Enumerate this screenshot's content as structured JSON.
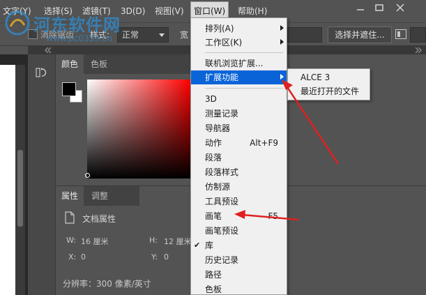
{
  "menubar": {
    "items": [
      {
        "label": "文字(Y)"
      },
      {
        "label": "选择(S)"
      },
      {
        "label": "滤镜(T)"
      },
      {
        "label": "3D(D)"
      },
      {
        "label": "视图(V)"
      },
      {
        "label": "窗口(W)"
      },
      {
        "label": "帮助(H)"
      }
    ]
  },
  "options_bar": {
    "feather_label": "消除锯齿",
    "style_label": "样式:",
    "style_value": "正常",
    "width_label": "宽",
    "select_mask_button": "选择并遮住..."
  },
  "color_panel": {
    "tabs": [
      {
        "label": "颜色"
      },
      {
        "label": "色板"
      }
    ],
    "foreground_color": "#000000",
    "background_color": "#ffffff"
  },
  "properties_panel": {
    "tabs": [
      {
        "label": "属性"
      },
      {
        "label": "调整"
      }
    ],
    "doc_props_label": "文档属性",
    "w_label": "W:",
    "w_value": "16 厘米",
    "h_label": "H:",
    "h_value": "12 厘米",
    "x_label": "X:",
    "x_value": "0",
    "y_label": "Y:",
    "y_value": "0",
    "resolution": "分辨率：300 像素/英寸"
  },
  "window_menu": {
    "items": [
      {
        "label": "排列(A)",
        "submenu": true
      },
      {
        "label": "工作区(K)",
        "submenu": true
      },
      {
        "label": "联机浏览扩展..."
      },
      {
        "label": "扩展功能",
        "submenu": true,
        "highlighted": true
      },
      {
        "label": "3D"
      },
      {
        "label": "测量记录"
      },
      {
        "label": "导航器"
      },
      {
        "label": "动作",
        "shortcut": "Alt+F9"
      },
      {
        "label": "段落"
      },
      {
        "label": "段落样式"
      },
      {
        "label": "仿制源"
      },
      {
        "label": "工具预设"
      },
      {
        "label": "画笔",
        "shortcut": "F5"
      },
      {
        "label": "画笔预设"
      },
      {
        "label": "库",
        "checked": true
      },
      {
        "label": "历史记录"
      },
      {
        "label": "路径"
      },
      {
        "label": "色板"
      }
    ]
  },
  "extensions_submenu": {
    "items": [
      {
        "label": "ALCE 3"
      },
      {
        "label": "最近打开的文件"
      }
    ]
  },
  "watermark": {
    "title": "河东软件网",
    "url": "www.pc0359.cn"
  },
  "annotation_color": "#e02020"
}
